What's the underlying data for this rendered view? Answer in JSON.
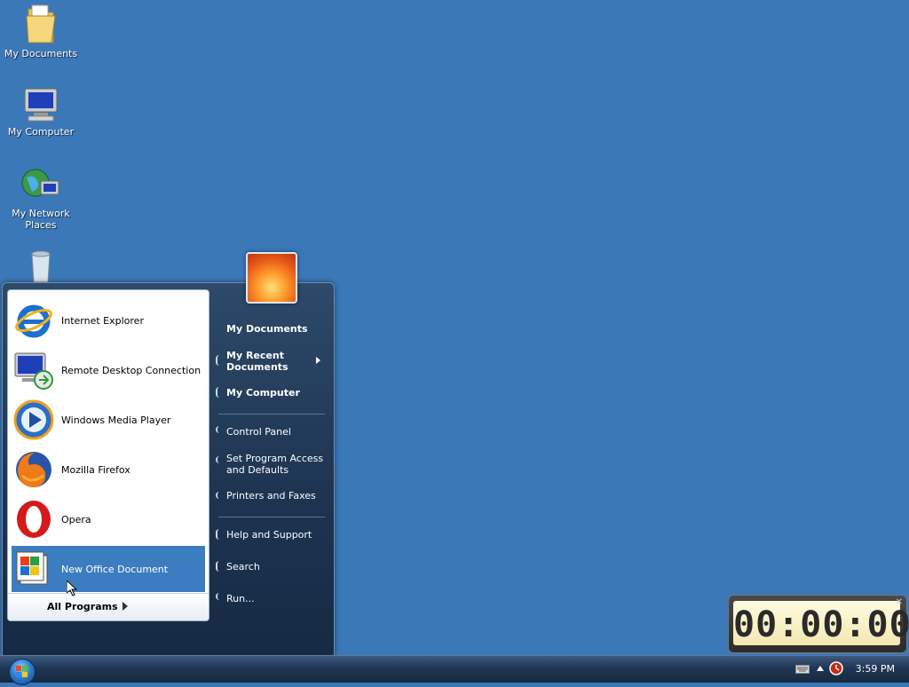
{
  "desktop": {
    "icons": [
      {
        "label": "My Documents"
      },
      {
        "label": "My Computer"
      },
      {
        "label": "My Network Places"
      }
    ]
  },
  "start_menu": {
    "programs": [
      {
        "label": "Internet Explorer",
        "icon": "internet-explorer-icon"
      },
      {
        "label": "Remote Desktop Connection",
        "icon": "remote-desktop-icon"
      },
      {
        "label": "Windows Media Player",
        "icon": "media-player-icon"
      },
      {
        "label": "Mozilla Firefox",
        "icon": "firefox-icon"
      },
      {
        "label": "Opera",
        "icon": "opera-icon"
      },
      {
        "label": "New Office Document",
        "icon": "office-document-icon"
      }
    ],
    "all_programs": "All Programs",
    "right": {
      "my_documents": "My Documents",
      "my_recent_documents": "My Recent Documents",
      "my_computer": "My Computer",
      "control_panel": "Control Panel",
      "set_program_access": "Set Program Access and Defaults",
      "printers_and_faxes": "Printers and Faxes",
      "help_and_support": "Help and Support",
      "search": "Search",
      "run": "Run..."
    }
  },
  "taskbar": {
    "clock": "3:59 PM"
  },
  "gadget": {
    "time": "00:00:00"
  },
  "colors": {
    "desktop": "#3a78b8",
    "selection": "#3c7cc0"
  }
}
